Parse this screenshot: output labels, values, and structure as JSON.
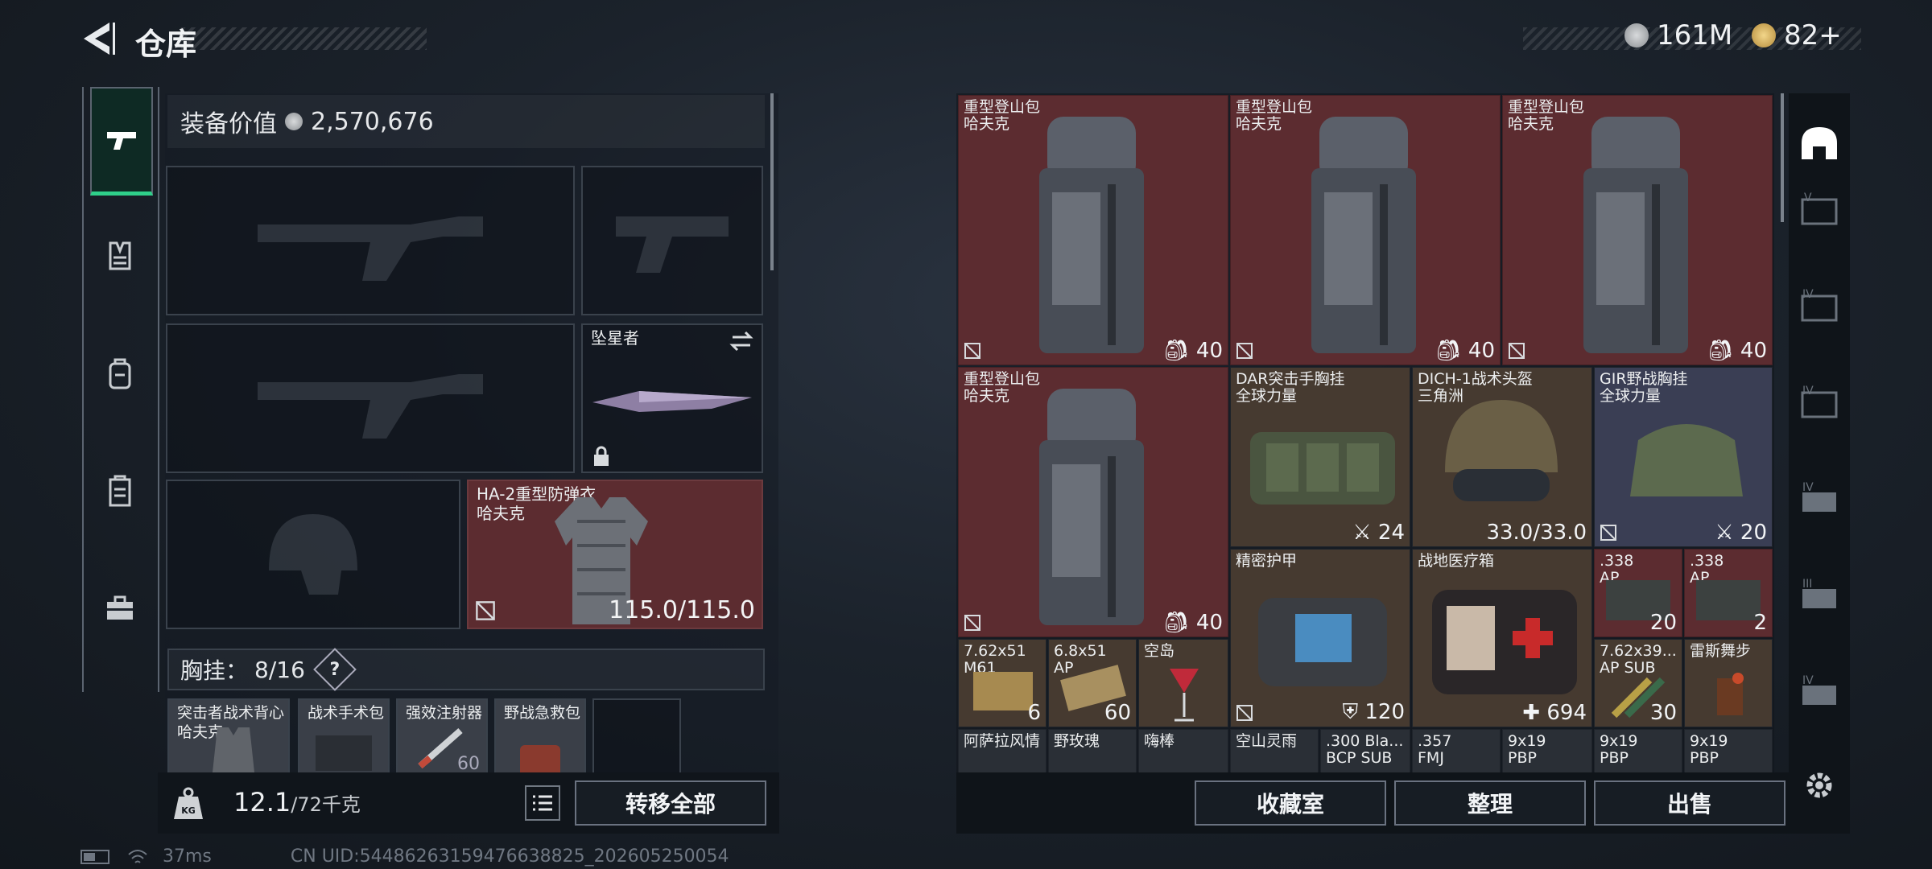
{
  "header": {
    "title": "仓库",
    "currency_silver": "161M",
    "currency_gold": "82+"
  },
  "left_tabs": [
    {
      "icon": "pistol-icon",
      "active": true
    },
    {
      "icon": "vest-icon",
      "active": false
    },
    {
      "icon": "backpack-icon",
      "active": false
    },
    {
      "icon": "clipboard-icon",
      "active": false
    },
    {
      "icon": "briefcase-icon",
      "active": false
    }
  ],
  "equipment": {
    "value_label": "装备价值",
    "value": "2,570,676",
    "melee_label": "坠星者",
    "armor_name": "HA-2重型防弹衣",
    "armor_brand": "哈夫克",
    "armor_durability": "115.0/115.0",
    "chest_label": "胸挂：",
    "chest_used": "8",
    "chest_total": "/16",
    "chest_help": "?",
    "small_items": [
      {
        "name": "突击者战术背心",
        "brand": "哈夫克"
      },
      {
        "name": "战术手术包",
        "brand": ""
      },
      {
        "name": "强效注射器",
        "brand": "",
        "count": "60"
      },
      {
        "name": "野战急救包",
        "brand": ""
      },
      {
        "name": "",
        "brand": ""
      }
    ]
  },
  "weight": {
    "current": "12.1",
    "max": "/72千克",
    "unit_icon": "KG"
  },
  "buttons": {
    "transfer_all": "转移全部",
    "collection": "收藏室",
    "sort": "整理",
    "sell": "出售"
  },
  "status": {
    "ping": "37ms",
    "uid": "CN UID:54486263159476638825_202605250054"
  },
  "grid_items": {
    "backpacks": [
      {
        "name": "重型登山包",
        "brand": "哈夫克",
        "count": "40"
      },
      {
        "name": "重型登山包",
        "brand": "哈夫克",
        "count": "40"
      },
      {
        "name": "重型登山包",
        "brand": "哈夫克",
        "count": "40"
      },
      {
        "name": "重型登山包",
        "brand": "哈夫克",
        "count": "40"
      }
    ],
    "dar": {
      "name": "DAR突击手胸挂",
      "brand": "全球力量",
      "count": "24"
    },
    "dich": {
      "name": "DICH-1战术头盔",
      "brand": "三角洲",
      "count": "33.0/33.0"
    },
    "gir": {
      "name": "GIR野战胸挂",
      "brand": "全球力量",
      "count": "20"
    },
    "armor_plate": {
      "name": "精密护甲",
      "count": "120"
    },
    "medkit": {
      "name": "战地医疗箱",
      "count": "694"
    },
    "ammo338a": {
      "name": ".338",
      "sub": "AP",
      "count": "20"
    },
    "ammo338b": {
      "name": ".338",
      "sub": "AP",
      "count": "2"
    },
    "ammo762x51": {
      "name": "7.62x51",
      "sub": "M61",
      "count": "6"
    },
    "ammo68x51": {
      "name": "6.8x51",
      "sub": "AP",
      "count": "60"
    },
    "drink_kongdao": {
      "name": "空岛",
      "count": ""
    },
    "ammo762x39": {
      "name": "7.62x39...",
      "sub": "AP SUB",
      "count": "30"
    },
    "drink_leisi": {
      "name": "雷斯舞步",
      "count": ""
    },
    "bottom_row": [
      "阿萨拉风情",
      "野玫瑰",
      "嗨棒",
      "空山灵雨",
      ".300 Bla...",
      ".357",
      "9x19",
      "9x19",
      "9x19"
    ],
    "bottom_row_sub": [
      "",
      "",
      "",
      "",
      "BCP SUB",
      "FMJ",
      "PBP",
      "PBP",
      "PBP"
    ]
  },
  "right_tabs": [
    "helmet-tab-icon",
    "case-v-icon",
    "case-iv-icon",
    "case-iv2-icon",
    "case-iv3-icon",
    "case-iii-icon",
    "case-iv4-icon"
  ],
  "colors": {
    "red_rarity": "#5a2a2e",
    "gold_rarity": "#463a30",
    "purple_rarity": "#3a3e54",
    "active_tab": "#2fd08a"
  }
}
